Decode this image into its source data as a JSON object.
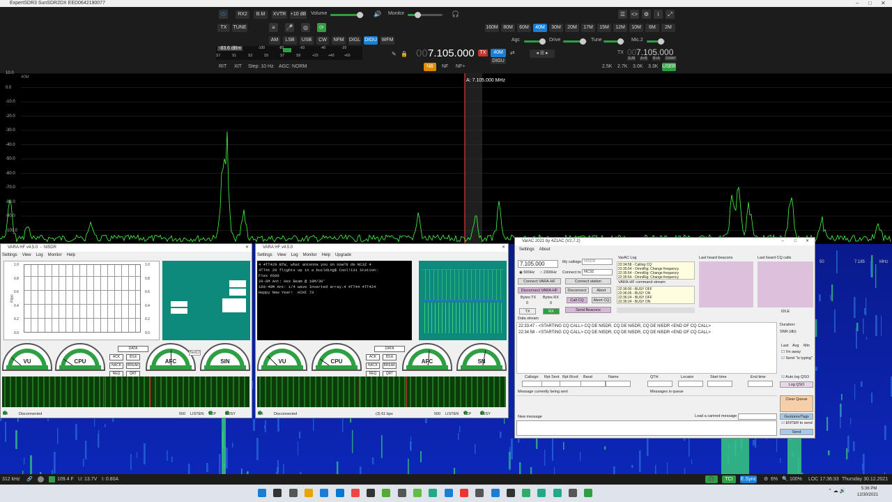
{
  "app": {
    "title": "ExpertSDR3 SunSDR2DX EED0642190077"
  },
  "toolbar": {
    "rx2": "RX2",
    "bm": "B.M",
    "xvtr": "XVTR",
    "plus10": "+10 dB",
    "volume": "Volume",
    "monitor": "Monitor",
    "tx": "TX",
    "tune": "TUNE"
  },
  "bands": [
    "160M",
    "80M",
    "60M",
    "40M",
    "30M",
    "20M",
    "17M",
    "15M",
    "12M",
    "10M",
    "6M",
    "2M"
  ],
  "active_band": "40M",
  "modes": [
    "AM",
    "LSB",
    "USB",
    "CW",
    "NFM",
    "DIGL",
    "DIGU",
    "WFM"
  ],
  "active_mode": "DIGU",
  "smeter": {
    "dbm": "-83.6 dBm",
    "scale": [
      "-100",
      "-80",
      "-60",
      "-40",
      "-20"
    ],
    "s_scale": [
      "S7",
      "S1",
      "S3",
      "S5",
      "S7",
      "S9",
      "+20",
      "+40",
      "+60"
    ]
  },
  "vfo_a": {
    "freq_dim": "00",
    "freq": "7.105.000",
    "band": "40M",
    "mode": "DIGU"
  },
  "vfo_b": {
    "freq_dim": "00",
    "freq": "7.105.000",
    "buttons": [
      "SUB",
      "A>B",
      "B>A",
      "SWAP"
    ]
  },
  "agc": {
    "label": "Agc",
    "drive": "Drive",
    "tune": "Tune",
    "mic": "Mic.2"
  },
  "row3": {
    "rit": "RIT",
    "xit": "XIT",
    "step": "Step: 10 Hz",
    "agc": "AGC: NORM",
    "nb": "NB",
    "nf": "NF",
    "nfplus": "NF+"
  },
  "filters": [
    "2.5K",
    "2.7K",
    "3.0K",
    "3.3K",
    "USER"
  ],
  "spectrum": {
    "band_tag": "40M",
    "marker": "A: 7.105.000 MHz",
    "db_labels": [
      "10.0",
      "0.0",
      "-10.0",
      "-20.0",
      "-30.0",
      "-40.0",
      "-50.0",
      "-60.0",
      "-70.0",
      "-80.0",
      "-90.0",
      "-100.0"
    ],
    "freq_labels": [
      "50",
      "7.185",
      "MHz"
    ],
    "colors": {
      "line": "#44ff44",
      "marker": "#ff3030"
    }
  },
  "vara1": {
    "title": "VARA HF v4.5.0",
    "call": "NI5DR",
    "menu": [
      "Settings",
      "View",
      "Log",
      "Monitor",
      "Help"
    ],
    "chart_y_left": [
      "1.0",
      "0.8",
      "0.6",
      "0.4",
      "0.2",
      "0.0"
    ],
    "chart_y_right": [
      "1.0",
      "0.8",
      "0.6",
      "0.4",
      "0.2",
      "0.0"
    ],
    "ylabel": "Kbps",
    "gauges": [
      "VU",
      "CPU",
      "AFC",
      "SIN"
    ],
    "buttons": [
      "DATA",
      "ACK",
      "IDLE",
      "NACK",
      "BREAK",
      "REQ",
      "QRT"
    ],
    "status": "Disconnected",
    "speed": "500",
    "listen": "LISTEN",
    "tcp": "TCP",
    "busy": "BUSY",
    "rx": "RX",
    "text_tag": "Text12"
  },
  "vara2": {
    "title": "VARA HF v4.5.0",
    "menu": [
      "Settings",
      "View",
      "Log",
      "Monitor",
      "Help",
      "Upgrade"
    ],
    "console": [
      "4 4TT429 BTW, what antenna you on now?8 de NC3Z 4",
      "4TT4t 20 flights up in a building$ Cool!131 Station:",
      "Flex 6500",
      "20-6M Ant: Hex Beam @ 10M/30'",
      "160-40M Ant: 1/4 wave Inverted array.4 4TT44 4TT424",
      "Happy New Year!  HIHI 73"
    ],
    "gauges": [
      "VU",
      "CPU",
      "AFC",
      "SN"
    ],
    "buttons": [
      "DATA",
      "ACK",
      "IDLE",
      "NACK",
      "BREAK",
      "REQ",
      "QRT"
    ],
    "status": "Disconnected",
    "bps": "(3) 61 bps",
    "speed": "500",
    "listen": "LISTEN",
    "tcp": "TCP",
    "busy": "BUSY",
    "rx": "RX"
  },
  "varac": {
    "title": "VarAC 2021 by 4Z1AC (V2.7.2)",
    "menu": [
      "Settings",
      "About"
    ],
    "freq": "7.105.000",
    "bw500": "500Hz",
    "bw2300": "2300Hz",
    "my_callsign_label": "My callsign",
    "my_callsign": "NI5DR",
    "connect_to_label": "Connect to",
    "connect_to": "NC3Z",
    "connect_vara": "Connect VARA-HF",
    "connect_station": "Connect station",
    "disconnect_vara": "Disconnect VARA-HF",
    "disconnect": "Disconnect",
    "abort": "Abort",
    "bytes_tx": "Bytes TX",
    "bytes_rx": "Bytes RX",
    "bytes_tx_val": "0",
    "bytes_rx_val": "0",
    "tx": "TX",
    "rx": "RX",
    "call_cq": "Call CQ",
    "abort_cq": "Abort CQ",
    "send_beacons": "Send Beacons",
    "log_title": "VarAC Log",
    "log": [
      "22:34:58 - Calling CQ",
      "22:35:54 - OmniRig: Change frequency",
      "22:35:54 - OmniRig: Change frequency",
      "22:35:54 - OmniRig: Change frequency"
    ],
    "cmd_title": "VARA-HF command stream",
    "cmd": [
      "22:36:00 - BUSY OFF",
      "22:36:05 - BUSY ON",
      "22:36:24 - BUSY OFF",
      "22:36:24 - BUSY ON"
    ],
    "beacons_title": "Last heard beacons",
    "cq_title": "Last heard CQ calls",
    "idle": "IDLE",
    "data_stream_title": "Data stream",
    "data_stream": [
      "22:33:47 - <STARTING CQ CALL> CQ DE NI5DR, CQ DE NI5DR, CQ DE NI5DR <END OF CQ CALL>",
      "22:34:58 - <STARTING CQ CALL> CQ DE NI5DR, CQ DE NI5DR, CQ DE NI5DR <END OF CQ CALL>"
    ],
    "duration": "Duration:",
    "snr": "SNR (db):",
    "last": "Last",
    "avg": "Avg",
    "min": "Min",
    "im_away": "I'm away",
    "send_typing": "Send \"is typing\"",
    "table_headers": [
      "Callsign",
      "Rpt Sent",
      "Rpt Rcvd",
      "Band",
      "Name",
      "QTH",
      "Locator",
      "Start time",
      "End time"
    ],
    "auto_log": "Auto log QSO",
    "log_qso": "Log QSO",
    "msg_sent": "Message currently being sent",
    "msg_queue": "Messages in queue",
    "clear_queue": "Clear Queue",
    "new_message": "New message",
    "load_canned": "Load a canned message",
    "gestures": "Gestures/Tags",
    "enter_send": "ENTER to send",
    "send": "Send"
  },
  "bottom": {
    "khz": "312 kHz",
    "temp": "109.4 F",
    "volts": "U: 13.7V",
    "amps": "I: 0.80A",
    "tci": "TCI",
    "esync": "E.Sync",
    "cpu": "6%",
    "zoom": "100%",
    "loc": "LOC 17:36:33",
    "date": "Thursday 30.12.2021"
  },
  "taskbar": {
    "time": "5:36 PM",
    "date": "12/30/2021"
  }
}
